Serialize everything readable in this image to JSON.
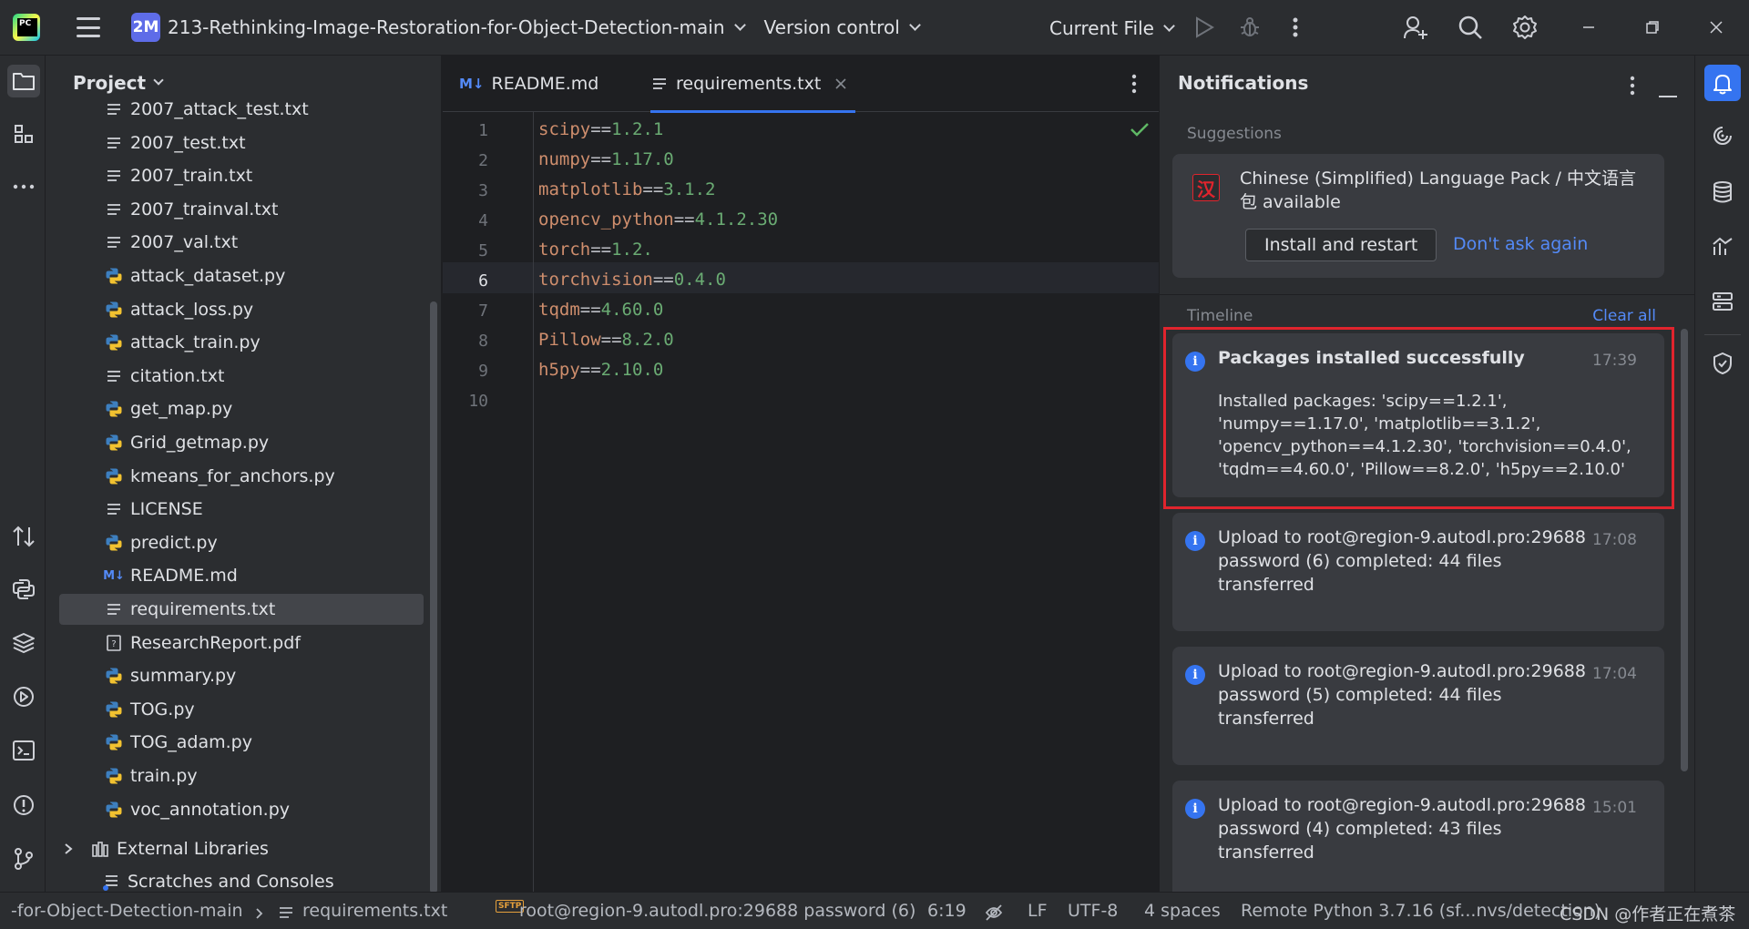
{
  "titlebar": {
    "project_badge": "2M",
    "project_name": "213-Rethinking-Image-Restoration-for-Object-Detection-main",
    "version_control": "Version control",
    "run_config": "Current File"
  },
  "project_panel": {
    "title": "Project",
    "items": [
      {
        "label": "2007_attack_test.txt",
        "type": "txt"
      },
      {
        "label": "2007_test.txt",
        "type": "txt"
      },
      {
        "label": "2007_train.txt",
        "type": "txt"
      },
      {
        "label": "2007_trainval.txt",
        "type": "txt"
      },
      {
        "label": "2007_val.txt",
        "type": "txt"
      },
      {
        "label": "attack_dataset.py",
        "type": "py"
      },
      {
        "label": "attack_loss.py",
        "type": "py"
      },
      {
        "label": "attack_train.py",
        "type": "py"
      },
      {
        "label": "citation.txt",
        "type": "txt"
      },
      {
        "label": "get_map.py",
        "type": "py"
      },
      {
        "label": "Grid_getmap.py",
        "type": "py"
      },
      {
        "label": "kmeans_for_anchors.py",
        "type": "py"
      },
      {
        "label": "LICENSE",
        "type": "txt"
      },
      {
        "label": "predict.py",
        "type": "py"
      },
      {
        "label": "README.md",
        "type": "md"
      },
      {
        "label": "requirements.txt",
        "type": "txt"
      },
      {
        "label": "ResearchReport.pdf",
        "type": "pdf"
      },
      {
        "label": "summary.py",
        "type": "py"
      },
      {
        "label": "TOG.py",
        "type": "py"
      },
      {
        "label": "TOG_adam.py",
        "type": "py"
      },
      {
        "label": "train.py",
        "type": "py"
      },
      {
        "label": "voc_annotation.py",
        "type": "py"
      }
    ],
    "external_libraries": "External Libraries",
    "scratches": "Scratches and Consoles"
  },
  "editor": {
    "tabs": [
      {
        "label": "README.md"
      },
      {
        "label": "requirements.txt"
      }
    ],
    "lines": [
      {
        "num": "1",
        "pkg": "scipy",
        "op": "==",
        "ver": "1.2.1"
      },
      {
        "num": "2",
        "pkg": "numpy",
        "op": "==",
        "ver": "1.17.0"
      },
      {
        "num": "3",
        "pkg": "matplotlib",
        "op": "==",
        "ver": "3.1.2"
      },
      {
        "num": "4",
        "pkg": "opencv_python",
        "op": "==",
        "ver": "4.1.2.30"
      },
      {
        "num": "5",
        "pkg": "torch",
        "op": "==",
        "ver": "1.2."
      },
      {
        "num": "6",
        "pkg": "torchvision",
        "op": "==",
        "ver": "0.4.0"
      },
      {
        "num": "7",
        "pkg": "tqdm",
        "op": "==",
        "ver": "4.60.0"
      },
      {
        "num": "8",
        "pkg": "Pillow",
        "op": "==",
        "ver": "8.2.0"
      },
      {
        "num": "9",
        "pkg": "h5py",
        "op": "==",
        "ver": "2.10.0"
      },
      {
        "num": "10",
        "pkg": "",
        "op": "",
        "ver": ""
      }
    ]
  },
  "notifications": {
    "title": "Notifications",
    "suggestions_label": "Suggestions",
    "suggestion": {
      "icon_glyph": "汉",
      "text": "Chinese (Simplified) Language Pack / 中文语言包 available",
      "install_button": "Install and restart",
      "dismiss_link": "Don't ask again"
    },
    "timeline_label": "Timeline",
    "clear_all": "Clear all",
    "items": [
      {
        "title": "Packages installed successfully",
        "time": "17:39",
        "body": "Installed packages: 'scipy==1.2.1', 'numpy==1.17.0', 'matplotlib==3.1.2', 'opencv_python==4.1.2.30', 'torchvision==0.4.0', 'tqdm==4.60.0', 'Pillow==8.2.0', 'h5py==2.10.0'"
      },
      {
        "title": "Upload to root@region-9.autodl.pro:29688 password (6) completed: 44 files transferred",
        "time": "17:08"
      },
      {
        "title": "Upload to root@region-9.autodl.pro:29688 password (5) completed: 44 files transferred",
        "time": "17:04"
      },
      {
        "title": "Upload to root@region-9.autodl.pro:29688 password (4) completed: 43 files transferred",
        "time": "15:01"
      }
    ]
  },
  "statusbar": {
    "breadcrumb_project": "-for-Object-Detection-main",
    "breadcrumb_file": "requirements.txt",
    "sftp_badge": "SFTP",
    "remote": "root@region-9.autodl.pro:29688 password (6)",
    "position": "6:19",
    "line_ending": "LF",
    "encoding": "UTF-8",
    "indent": "4 spaces",
    "interpreter": "Remote Python 3.7.16 (sf...nvs/detection)",
    "watermark": "CSDN @作者正在煮茶"
  },
  "colors": {
    "accent": "#3574f0",
    "highlight_box": "#e0242d",
    "package_name": "#cf8e6d",
    "version": "#6aab73"
  }
}
